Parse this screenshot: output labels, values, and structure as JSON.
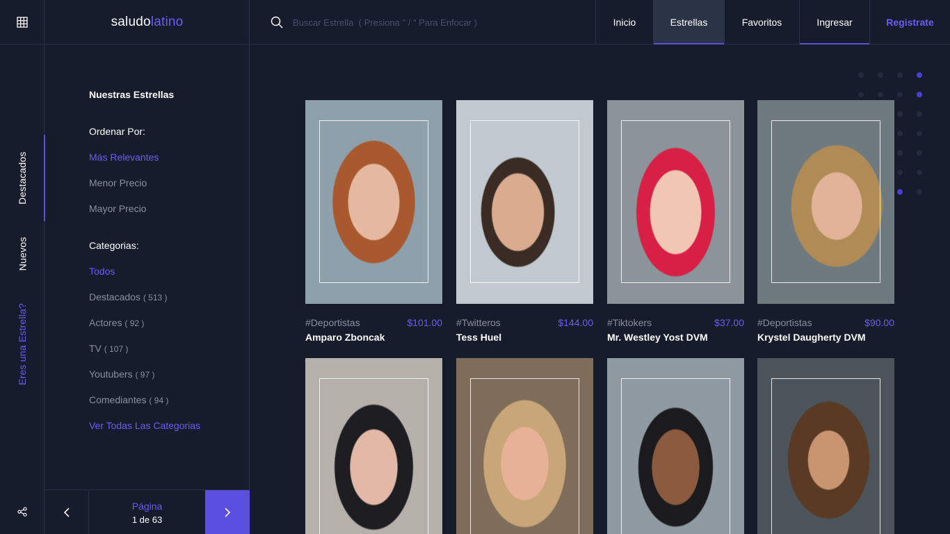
{
  "logo": {
    "part1": "saludo",
    "part2": "latino"
  },
  "search": {
    "placeholder": "Buscar Estrella  ( Presiona \" / \" Para Enfocar )"
  },
  "nav": [
    {
      "label": "Inicio"
    },
    {
      "label": "Estrellas"
    },
    {
      "label": "Favoritos"
    },
    {
      "label": "Ingresar"
    },
    {
      "label": "Registrate"
    }
  ],
  "rail": {
    "tabs": [
      {
        "label": "Destacados"
      },
      {
        "label": "Nuevos"
      },
      {
        "label": "Eres una Estrella?"
      }
    ]
  },
  "sidebar": {
    "heading": "Nuestras Estrellas",
    "sort_label": "Ordenar Por:",
    "sort_options": [
      "Más Relevantes",
      "Menor Precio",
      "Mayor Precio"
    ],
    "categories_label": "Categorias:",
    "categories": [
      {
        "name": "Todos",
        "count": ""
      },
      {
        "name": "Destacados",
        "count": "( 513 )"
      },
      {
        "name": "Actores",
        "count": "( 92 )"
      },
      {
        "name": "TV",
        "count": "( 107 )"
      },
      {
        "name": "Youtubers",
        "count": "( 97 )"
      },
      {
        "name": "Comediantes",
        "count": "( 94 )"
      }
    ],
    "all_categories": "Ver Todas Las Categorias"
  },
  "pager": {
    "label": "Página",
    "value": "1 de 63"
  },
  "cards": [
    {
      "tag": "#Deportistas",
      "price": "$101.00",
      "name": "Amparo Zboncak"
    },
    {
      "tag": "#Twitteros",
      "price": "$144.00",
      "name": "Tess Huel"
    },
    {
      "tag": "#Tiktokers",
      "price": "$37.00",
      "name": "Mr. Westley Yost DVM"
    },
    {
      "tag": "#Deportistas",
      "price": "$90.00",
      "name": "Krystel Daugherty DVM"
    }
  ],
  "colors": {
    "accent": "#5b4fe0",
    "background": "#161c2c",
    "link": "#6a5ef0"
  }
}
